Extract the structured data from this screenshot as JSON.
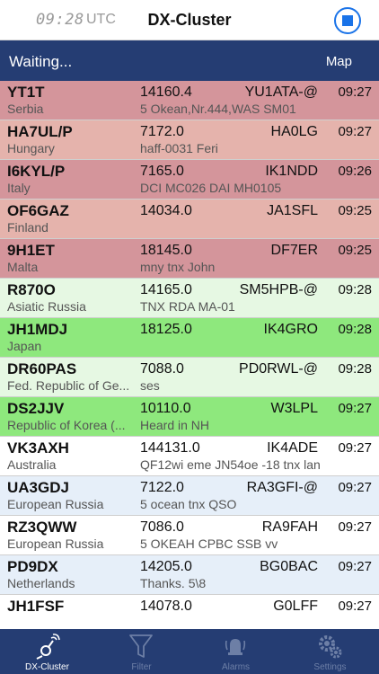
{
  "header": {
    "clock": "09:28",
    "clock_zone": "UTC",
    "title": "DX-Cluster",
    "stop_icon": "stop-circle-icon",
    "accent_color": "#1a73e8"
  },
  "status": {
    "text": "Waiting...",
    "map_label": "Map",
    "bar_color": "#253d73"
  },
  "spots": [
    {
      "call": "YT1T",
      "country": "Serbia",
      "freq": "14160.4",
      "spotter": "YU1ATA-@",
      "time": "09:27",
      "comment": "5 Okean,Nr.444,WAS SM01",
      "bg": "#d4959b"
    },
    {
      "call": "HA7UL/P",
      "country": "Hungary",
      "freq": "7172.0",
      "spotter": "HA0LG",
      "time": "09:27",
      "comment": "haff-0031 Feri",
      "bg": "#e5b3ac"
    },
    {
      "call": "I6KYL/P",
      "country": "Italy",
      "freq": "7165.0",
      "spotter": "IK1NDD",
      "time": "09:26",
      "comment": "DCI MC026 DAI MH0105",
      "bg": "#d4959b"
    },
    {
      "call": "OF6GAZ",
      "country": "Finland",
      "freq": "14034.0",
      "spotter": "JA1SFL",
      "time": "09:25",
      "comment": "",
      "bg": "#e5b3ac"
    },
    {
      "call": "9H1ET",
      "country": "Malta",
      "freq": "18145.0",
      "spotter": "DF7ER",
      "time": "09:25",
      "comment": "mny tnx John",
      "bg": "#d4959b"
    },
    {
      "call": "R870O",
      "country": "Asiatic Russia",
      "freq": "14165.0",
      "spotter": "SM5HPB-@",
      "time": "09:28",
      "comment": "TNX RDA MA-01",
      "bg": "#e6f8e3"
    },
    {
      "call": "JH1MDJ",
      "country": "Japan",
      "freq": "18125.0",
      "spotter": "IK4GRO",
      "time": "09:28",
      "comment": "",
      "bg": "#8ee87d"
    },
    {
      "call": "DR60PAS",
      "country": "Fed. Republic of Ge...",
      "freq": "7088.0",
      "spotter": "PD0RWL-@",
      "time": "09:28",
      "comment": "ses",
      "bg": "#e6f8e3"
    },
    {
      "call": "DS2JJV",
      "country": "Republic of Korea (...",
      "freq": "10110.0",
      "spotter": "W3LPL",
      "time": "09:27",
      "comment": "Heard in NH",
      "bg": "#8ee87d"
    },
    {
      "call": "VK3AXH",
      "country": "Australia",
      "freq": "144131.0",
      "spotter": "IK4ADE",
      "time": "09:27",
      "comment": "QF12wi eme JN54oe -18 tnx lan",
      "bg": "#ffffff"
    },
    {
      "call": "UA3GDJ",
      "country": "European Russia",
      "freq": "7122.0",
      "spotter": "RA3GFI-@",
      "time": "09:27",
      "comment": "5 ocean tnx QSO",
      "bg": "#e6eff9"
    },
    {
      "call": "RZ3QWW",
      "country": "European Russia",
      "freq": "7086.0",
      "spotter": "RA9FAH",
      "time": "09:27",
      "comment": "5 OKEAH CPBC SSB vv",
      "bg": "#ffffff"
    },
    {
      "call": "PD9DX",
      "country": "Netherlands",
      "freq": "14205.0",
      "spotter": "BG0BAC",
      "time": "09:27",
      "comment": "Thanks. 5\\8",
      "bg": "#e6eff9"
    },
    {
      "call": "JH1FSF",
      "country": "",
      "freq": "14078.0",
      "spotter": "G0LFF",
      "time": "09:27",
      "comment": "",
      "bg": "#ffffff"
    }
  ],
  "tabs": [
    {
      "label": "DX-Cluster",
      "icon": "antenna-icon",
      "active": true
    },
    {
      "label": "Filter",
      "icon": "funnel-icon",
      "active": false
    },
    {
      "label": "Alarms",
      "icon": "alarm-bell-icon",
      "active": false
    },
    {
      "label": "Settings",
      "icon": "gears-icon",
      "active": false
    }
  ]
}
